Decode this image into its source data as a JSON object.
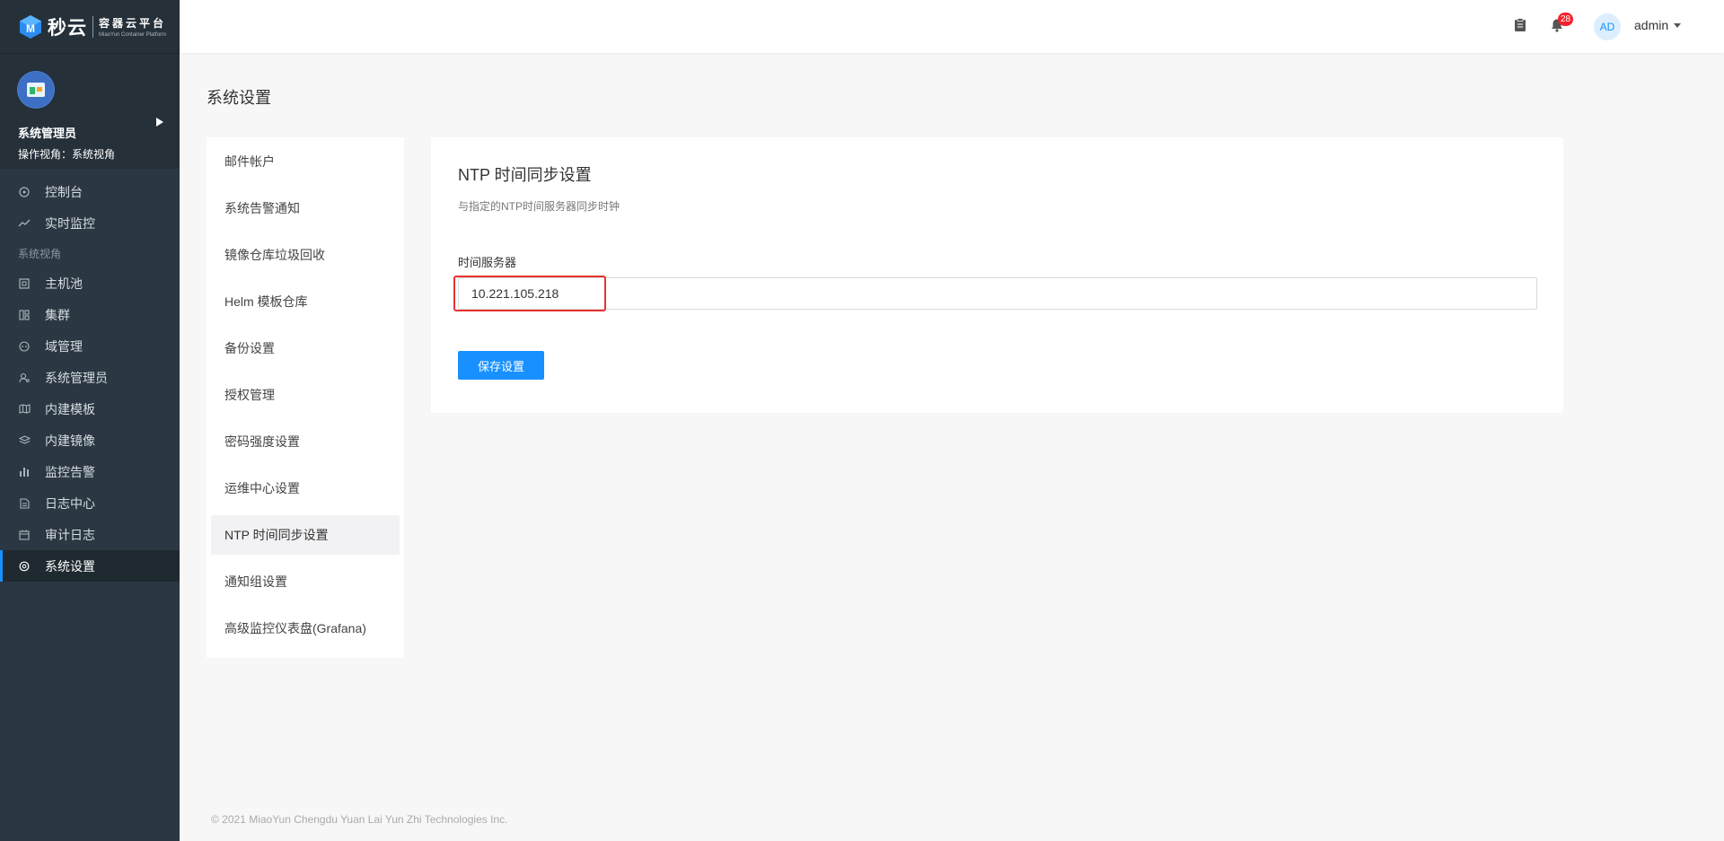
{
  "brand": {
    "name": "秒云",
    "sub_cn": "容器云平台",
    "sub_en": "MiaoYun Container Platform"
  },
  "user": {
    "name": "系统管理员",
    "role": "操作视角：系统视角"
  },
  "nav": {
    "items": [
      {
        "label": "控制台",
        "icon": "dashboard-icon"
      },
      {
        "label": "实时监控",
        "icon": "line-chart-icon"
      }
    ],
    "section_label": "系统视角",
    "section_items": [
      {
        "label": "主机池",
        "icon": "host-icon"
      },
      {
        "label": "集群",
        "icon": "cluster-icon"
      },
      {
        "label": "域管理",
        "icon": "domain-icon"
      },
      {
        "label": "系统管理员",
        "icon": "user-admin-icon"
      },
      {
        "label": "内建模板",
        "icon": "template-icon"
      },
      {
        "label": "内建镜像",
        "icon": "layers-icon"
      },
      {
        "label": "监控告警",
        "icon": "bar-chart-icon"
      },
      {
        "label": "日志中心",
        "icon": "log-icon"
      },
      {
        "label": "审计日志",
        "icon": "calendar-icon"
      },
      {
        "label": "系统设置",
        "icon": "settings-icon",
        "active": true
      }
    ]
  },
  "header": {
    "badge_count": "28",
    "avatar_initials": "AD",
    "username": "admin"
  },
  "page": {
    "title": "系统设置"
  },
  "settings_menu": [
    "邮件帐户",
    "系统告警通知",
    "镜像仓库垃圾回收",
    "Helm 模板仓库",
    "备份设置",
    "授权管理",
    "密码强度设置",
    "运维中心设置",
    "NTP 时间同步设置",
    "通知组设置",
    "高级监控仪表盘(Grafana)"
  ],
  "panel": {
    "title": "NTP 时间同步设置",
    "description": "与指定的NTP时间服务器同步时钟",
    "field_label": "时间服务器",
    "field_value": "10.221.105.218",
    "save_label": "保存设置"
  },
  "footer": {
    "copyright": "© 2021 MiaoYun Chengdu Yuan Lai Yun Zhi Technologies Inc."
  },
  "colors": {
    "sidebar_bg": "#2b3742",
    "accent": "#1890ff",
    "highlight": "#e8322e",
    "badge": "#f5222d"
  }
}
